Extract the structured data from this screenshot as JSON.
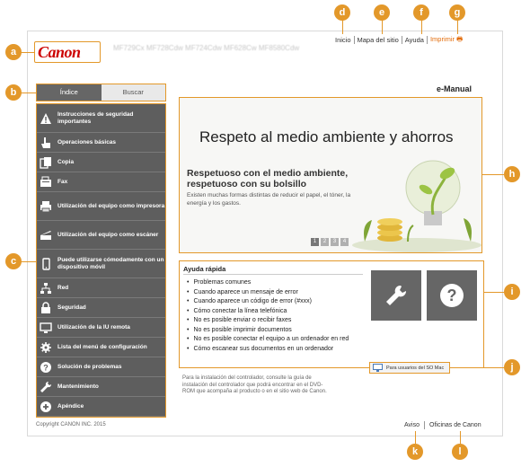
{
  "header": {
    "logo": "Canon",
    "model": "MF729Cx MF728Cdw MF724Cdw MF628Cw MF8580Cdw",
    "top_nav": {
      "home": "Inicio",
      "sitemap": "Mapa del sitio",
      "help": "Ayuda",
      "print": "Imprimir"
    },
    "emanual": "e-Manual"
  },
  "tabs": {
    "index": "Índice",
    "search": "Buscar"
  },
  "sidebar": {
    "items": [
      {
        "label": "Instrucciones de seguridad importantes",
        "icon": "warning-icon"
      },
      {
        "label": "Operaciones básicas",
        "icon": "hand-pointer-icon"
      },
      {
        "label": "Copia",
        "icon": "copy-icon"
      },
      {
        "label": "Fax",
        "icon": "fax-icon"
      },
      {
        "label": "Utilización del equipo como impresora",
        "icon": "printer-icon"
      },
      {
        "label": "Utilización del equipo como escáner",
        "icon": "scanner-icon"
      },
      {
        "label": "Puede utilizarse cómodamente con un dispositivo móvil",
        "icon": "mobile-icon"
      },
      {
        "label": "Red",
        "icon": "network-icon"
      },
      {
        "label": "Seguridad",
        "icon": "lock-icon"
      },
      {
        "label": "Utilización de la IU remota",
        "icon": "remote-ui-icon"
      },
      {
        "label": "Lista del menú de configuración",
        "icon": "gear-icon"
      },
      {
        "label": "Solución de problemas",
        "icon": "question-icon"
      },
      {
        "label": "Mantenimiento",
        "icon": "wrench-icon"
      },
      {
        "label": "Apéndice",
        "icon": "plus-icon"
      }
    ]
  },
  "hero": {
    "title": "Respeto al medio ambiente y ahorros",
    "subtitle": "Respetuoso con el medio ambiente, respetuoso con su bolsillo",
    "description": "Existen muchas formas distintas de reducir el papel, el tóner, la energía y los gastos.",
    "pages": [
      "1",
      "2",
      "3",
      "4"
    ]
  },
  "quick_help": {
    "title": "Ayuda rápida",
    "items": [
      "Problemas comunes",
      "Cuando aparece un mensaje de error",
      "Cuando aparece un código de error (#xxx)",
      "Cómo conectar la línea telefónica",
      "No es posible enviar o recibir faxes",
      "No es posible imprimir documentos",
      "No es posible conectar el equipo a un ordenador en red",
      "Cómo escanear sus documentos en un ordenador"
    ]
  },
  "mac_button": "Para usuarios del SO Mac",
  "install_note": "Para la instalación del controlador, consulte la guía de instalación del controlador que podrá encontrar en el DVD-ROM que acompaña al producto o en el sitio web de Canon.",
  "footer": {
    "copyright": "Copyright CANON INC. 2015",
    "notice": "Aviso",
    "offices": "Oficinas de Canon"
  },
  "callouts": [
    "a",
    "b",
    "c",
    "d",
    "e",
    "f",
    "g",
    "h",
    "i",
    "j",
    "k",
    "l"
  ],
  "colors": {
    "accent": "#e3982a",
    "logo": "#cc0000",
    "sidebar_bg": "#5e5e5e",
    "print_link": "#e36c0a"
  }
}
